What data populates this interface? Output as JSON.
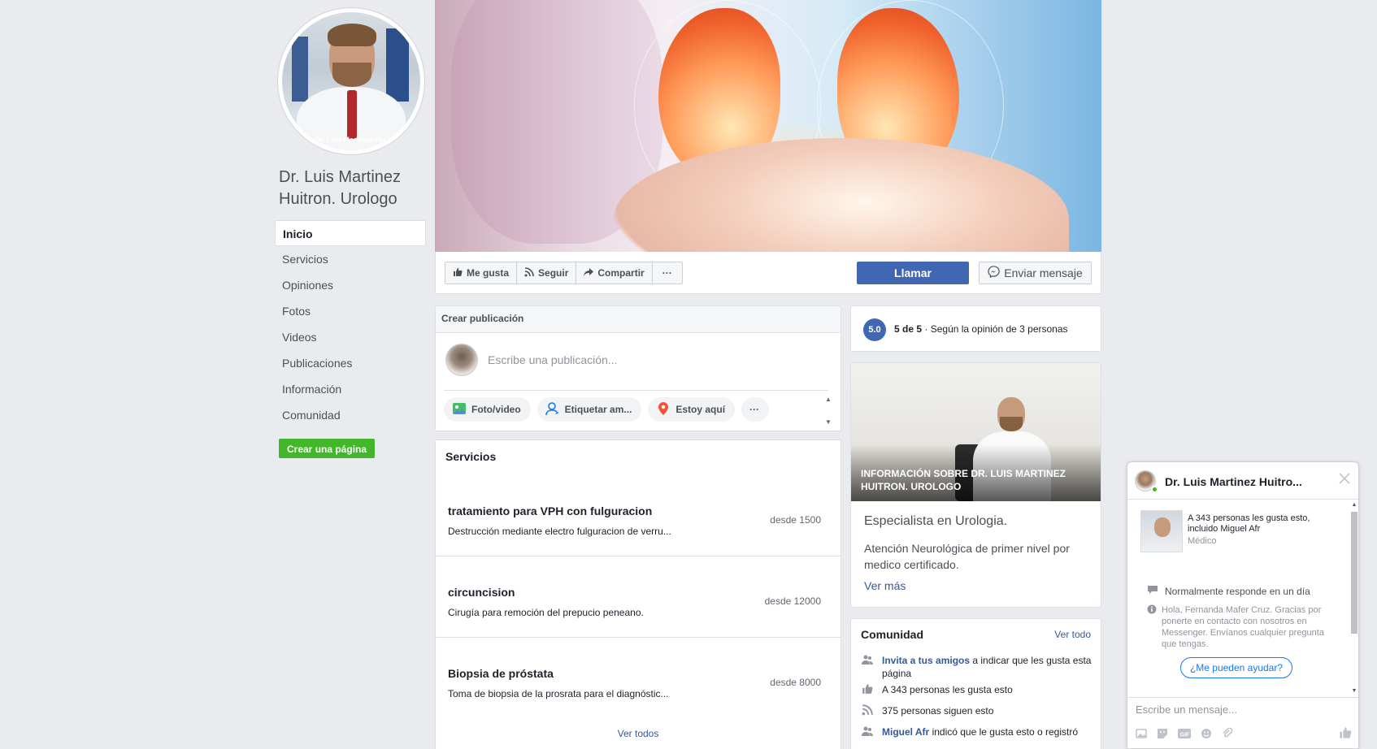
{
  "page": {
    "name": "Dr. Luis Martinez Huitron. Urologo",
    "avatar_watermark": "Dr. Luis Martinez Hu..."
  },
  "leftnav": {
    "items": [
      {
        "label": "Inicio",
        "active": true
      },
      {
        "label": "Servicios"
      },
      {
        "label": "Opiniones"
      },
      {
        "label": "Fotos"
      },
      {
        "label": "Videos"
      },
      {
        "label": "Publicaciones"
      },
      {
        "label": "Información"
      },
      {
        "label": "Comunidad"
      }
    ],
    "create_page": "Crear una página"
  },
  "actions": {
    "like": "Me gusta",
    "follow": "Seguir",
    "share": "Compartir",
    "more": "···",
    "call": "Llamar",
    "message": "Enviar mensaje"
  },
  "composer": {
    "header": "Crear publicación",
    "placeholder": "Escribe una publicación...",
    "photo": "Foto/video",
    "tag": "Etiquetar am...",
    "checkin": "Estoy aquí",
    "more": "···"
  },
  "services": {
    "title": "Servicios",
    "items": [
      {
        "name": "tratamiento para VPH con fulguracion",
        "desc": "Destrucción mediante electro fulguracion de verru...",
        "price": "desde 1500"
      },
      {
        "name": "circuncision",
        "desc": "Cirugía para remoción del prepucio peneano.",
        "price": "desde 12000"
      },
      {
        "name": "Biopsia de próstata",
        "desc": "Toma de biopsia de la prosrata para el diagnóstic...",
        "price": "desde 8000"
      }
    ],
    "view_all": "Ver todos"
  },
  "rating": {
    "score": "5.0",
    "out_of": "5 de 5",
    "separator": "·",
    "text": "Según la opinión de 3 personas"
  },
  "about": {
    "photo_label": "INFORMACIÓN SOBRE DR. LUIS MARTINEZ HUITRON. UROLOGO",
    "specialty": "Especialista en Urologia.",
    "description": "Atención Neurológica de primer nivel por medico certificado.",
    "more": "Ver más"
  },
  "community": {
    "title": "Comunidad",
    "view_all": "Ver todo",
    "invite_link": "Invita a tus amigos",
    "invite_rest": "a indicar que les gusta esta página",
    "likes": "A 343 personas les gusta esto",
    "followers": "375 personas siguen esto",
    "friend_name": "Miguel Afr",
    "friend_rest": "indicó que le gusta esto o registró"
  },
  "messenger": {
    "name": "Dr. Luis Martinez Huitro...",
    "likes": "A 343 personas les gusta esto, incluido Miguel Afr",
    "category": "Médico",
    "response": "Normalmente responde en un día",
    "welcome": "Hola, Fernanda Mafer Cruz. Gracias por ponerte en contacto con nosotros en Messenger. Envíanos cualquier pregunta que tengas.",
    "quick_reply": "¿Me pueden ayudar?",
    "input_placeholder": "Escribe un mensaje..."
  },
  "colors": {
    "brand": "#4267b2",
    "link": "#385898",
    "green": "#42b72a"
  }
}
